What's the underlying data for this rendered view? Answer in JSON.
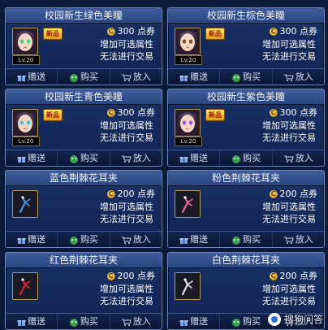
{
  "items": [
    {
      "title": "校园新生绿色美瞳",
      "badge": "新品",
      "level": "Lv.20",
      "price": "300 点券",
      "line1": "增加可选属性",
      "line2": "无法进行交易",
      "eye_color": "#4ad07a",
      "kind": "face"
    },
    {
      "title": "校园新生棕色美瞳",
      "badge": "新品",
      "level": "Lv.20",
      "price": "300 点券",
      "line1": "增加可选属性",
      "line2": "无法进行交易",
      "eye_color": "#8a4a20",
      "kind": "face"
    },
    {
      "title": "校园新生青色美瞳",
      "badge": "新品",
      "level": "Lv.20",
      "price": "300 点券",
      "line1": "增加可选属性",
      "line2": "无法进行交易",
      "eye_color": "#3ac8e0",
      "kind": "face"
    },
    {
      "title": "校园新生紫色美瞳",
      "badge": "新品",
      "level": "Lv.20",
      "price": "300 点券",
      "line1": "增加可选属性",
      "line2": "无法进行交易",
      "eye_color": "#a050e0",
      "kind": "face"
    },
    {
      "title": "蓝色荆棘花耳夹",
      "badge": "",
      "level": "",
      "price": "200 点券",
      "line1": "增加可选属性",
      "line2": "无法进行交易",
      "eye_color": "#3a9af0",
      "kind": "clip"
    },
    {
      "title": "粉色荆棘花耳夹",
      "badge": "",
      "level": "",
      "price": "200 点券",
      "line1": "增加可选属性",
      "line2": "无法进行交易",
      "eye_color": "#f060a0",
      "kind": "clip"
    },
    {
      "title": "红色荆棘花耳夹",
      "badge": "",
      "level": "",
      "price": "200 点券",
      "line1": "增加可选属性",
      "line2": "无法进行交易",
      "eye_color": "#e02030",
      "kind": "clip"
    },
    {
      "title": "白色荆棘花耳夹",
      "badge": "",
      "level": "",
      "price": "200 点券",
      "line1": "增加可选属性",
      "line2": "无法进行交易",
      "eye_color": "#e0e0f0",
      "kind": "clip"
    }
  ],
  "buttons": {
    "gift": "赠送",
    "buy": "购买",
    "cart": "放入"
  },
  "coin_symbol": "C",
  "watermark": "搜狗问答"
}
